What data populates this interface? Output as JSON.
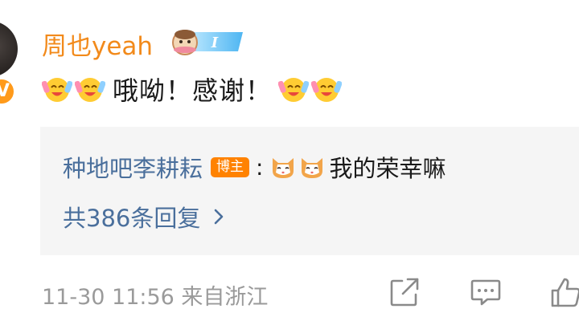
{
  "comment": {
    "username": "周也yeah",
    "text": "哦呦！感谢！",
    "meta": "11-30 11:56 来自浙江"
  },
  "reply": {
    "author": "种地吧李耕耘",
    "host_tag": "博主",
    "colon": ":",
    "text": "我的荣幸嘛",
    "view_all": "共386条回复"
  },
  "colors": {
    "username": "#f28a1b",
    "link": "#4a6f9c",
    "host_tag_bg": "#ff8200",
    "reply_bg": "#f5f5f5",
    "meta": "#9a9a9a"
  },
  "icons": {
    "badge": "member-badge-icon",
    "verified": "verified-v-icon",
    "emoji_a": "cheering-emoji-icon",
    "emoji_b": "cat-face-emoji-icon",
    "share": "share-icon",
    "reply": "comment-icon",
    "like": "like-icon",
    "chevron": "chevron-right-icon"
  }
}
